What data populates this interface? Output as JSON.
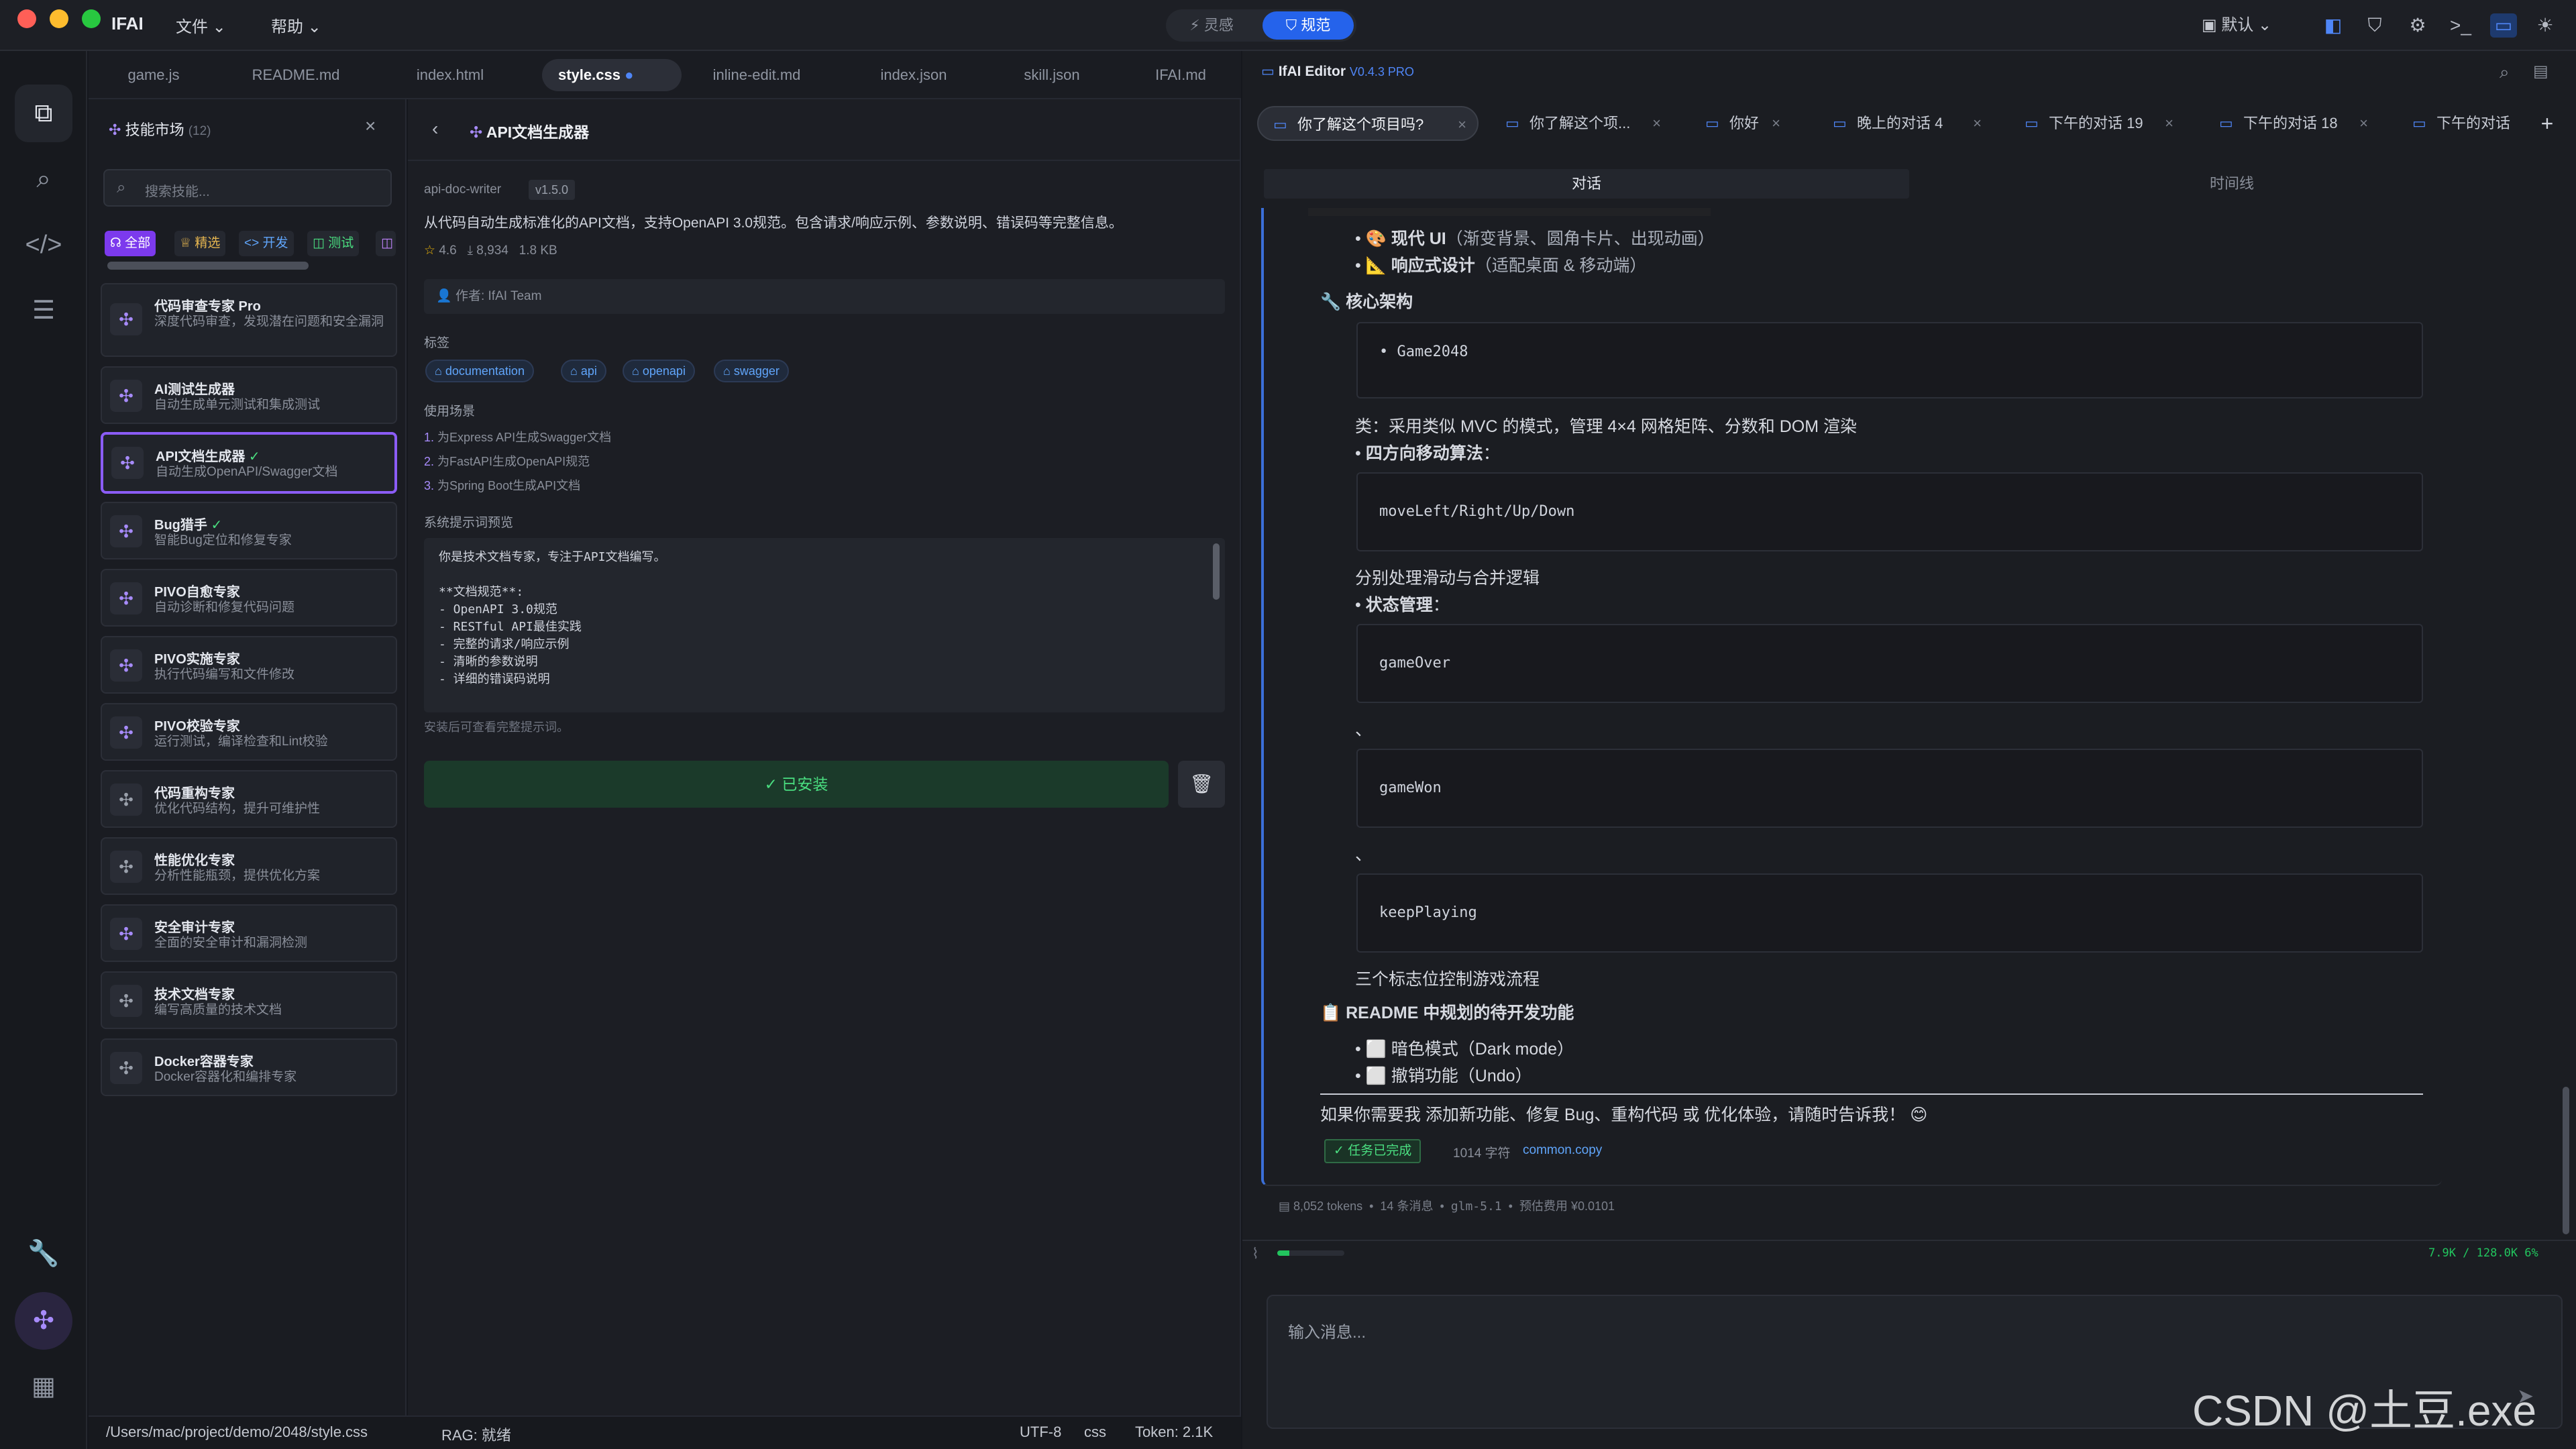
{
  "titlebar": {
    "app_name": "IFAI",
    "menu_file": "文件",
    "menu_help": "帮助",
    "mode_inspiration": "灵感",
    "mode_spec": "规范",
    "layout_label": "默认"
  },
  "editor_tabs": [
    "game.js",
    "README.md",
    "index.html",
    "style.css",
    "inline-edit.md",
    "index.json",
    "skill.json",
    "IFAI.md"
  ],
  "skills": {
    "title": "技能市场",
    "count": "(12)",
    "search_placeholder": "搜索技能...",
    "filters": [
      "全部",
      "精选",
      "开发",
      "测试"
    ],
    "items": [
      {
        "name": "代码审查专家 Pro",
        "desc": "深度代码审查，发现潜在问题和安全漏洞"
      },
      {
        "name": "AI测试生成器",
        "desc": "自动生成单元测试和集成测试"
      },
      {
        "name": "API文档生成器",
        "desc": "自动生成OpenAPI/Swagger文档",
        "check": "✓"
      },
      {
        "name": "Bug猎手",
        "desc": "智能Bug定位和修复专家",
        "check": "✓"
      },
      {
        "name": "PIVO自愈专家",
        "desc": "自动诊断和修复代码问题"
      },
      {
        "name": "PIVO实施专家",
        "desc": "执行代码编写和文件修改"
      },
      {
        "name": "PIVO校验专家",
        "desc": "运行测试，编译检查和Lint校验"
      },
      {
        "name": "代码重构专家",
        "desc": "优化代码结构，提升可维护性"
      },
      {
        "name": "性能优化专家",
        "desc": "分析性能瓶颈，提供优化方案"
      },
      {
        "name": "安全审计专家",
        "desc": "全面的安全审计和漏洞检测"
      },
      {
        "name": "技术文档专家",
        "desc": "编写高质量的技术文档"
      },
      {
        "name": "Docker容器专家",
        "desc": "Docker容器化和编排专家"
      }
    ]
  },
  "detail": {
    "title": "API文档生成器",
    "id": "api-doc-writer",
    "version": "v1.5.0",
    "description": "从代码自动生成标准化的API文档，支持OpenAPI 3.0规范。包含请求/响应示例、参数说明、错误码等完整信息。",
    "rating": "4.6",
    "downloads": "8,934",
    "size": "1.8 KB",
    "author": "作者: IfAI Team",
    "tags_label": "标签",
    "tags": [
      "documentation",
      "api",
      "openapi",
      "swagger"
    ],
    "usage_label": "使用场景",
    "usage": [
      "为Express API生成Swagger文档",
      "为FastAPI生成OpenAPI规范",
      "为Spring Boot生成API文档"
    ],
    "prompt_label": "系统提示词预览",
    "prompt_lines": [
      "你是技术文档专家，专注于API文档编写。",
      "",
      "**文档规范**:",
      "- OpenAPI 3.0规范",
      "- RESTful API最佳实践",
      "- 完整的请求/响应示例",
      "- 清晰的参数说明",
      "- 详细的错误码说明"
    ],
    "prompt_hint": "安装后可查看完整提示词。",
    "installed_label": "已安装"
  },
  "statusbar": {
    "path": "/Users/mac/project/demo/2048/style.css",
    "rag": "RAG: 就绪",
    "encoding": "UTF-8",
    "lang": "css",
    "tokens": "Token: 2.1K"
  },
  "chat": {
    "title": "IfAI Editor",
    "version": "V0.4.3 PRO",
    "tabs": [
      "你了解这个项目吗?",
      "你了解这个项...",
      "你好",
      "晚上的对话 4",
      "下午的对话 19",
      "下午的对话 18",
      "下午的对话"
    ],
    "subtabs": [
      "对话",
      "时间线"
    ],
    "lines": {
      "modern_ui_b": "现代 UI",
      "modern_ui": "（渐变背景、圆角卡片、出现动画）",
      "responsive_b": "响应式设计",
      "responsive": "（适配桌面 & 移动端）",
      "arch_heading": "核心架构",
      "game2048": "Game2048",
      "class_line": "类：采用类似 MVC 的模式，管理 4×4 网格矩阵、分数和 DOM 渲染",
      "move_b": "四方向移动算法",
      "move_code": "moveLeft/Right/Up/Down",
      "move_desc": "分别处理滑动与合并逻辑",
      "state_b": "状态管理",
      "code1": "gameOver",
      "code2": "gameWon",
      "code3": "keepPlaying",
      "sep": "、",
      "flags_desc": "三个标志位控制游戏流程",
      "readme_heading": "README 中规划的待开发功能",
      "todo1": "暗色模式（Dark mode）",
      "todo2": "撤销功能（Undo）",
      "closing": "如果你需要我 添加新功能、修复 Bug、重构代码 或 优化体验，请随时告诉我！ 😊",
      "task_done": "任务已完成",
      "char_count": "1014 字符",
      "copy_label": "common.copy"
    },
    "stats": {
      "tokens": "8,052 tokens",
      "messages": "14 条消息",
      "model": "glm-5.1",
      "cost": "预估费用 ¥0.0101"
    },
    "context": {
      "label": "7.9K / 128.0K 6%",
      "fill_pct": 6
    },
    "input_placeholder": "输入消息..."
  },
  "watermark": "CSDN @土豆.exe"
}
